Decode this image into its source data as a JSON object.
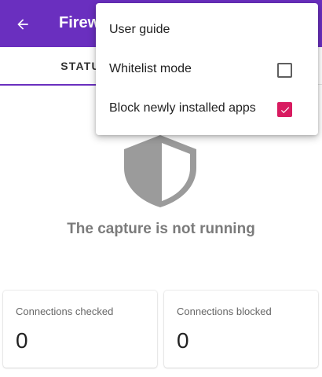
{
  "toolbar": {
    "title": "Firew",
    "back_icon": "arrow-left-icon",
    "background": "#6a2fbf"
  },
  "tabs": [
    {
      "label": "STATU",
      "selected": true
    }
  ],
  "main": {
    "shield_icon": "shield-icon",
    "status_text": "The capture is not running"
  },
  "cards": [
    {
      "label": "Connections checked",
      "value": "0"
    },
    {
      "label": "Connections blocked",
      "value": "0"
    }
  ],
  "menu": {
    "items": [
      {
        "label": "User guide"
      },
      {
        "label": "Whitelist mode",
        "checked": false
      },
      {
        "label": "Block newly installed apps",
        "checked": true
      }
    ],
    "checkbox_color": "#d81b60"
  }
}
